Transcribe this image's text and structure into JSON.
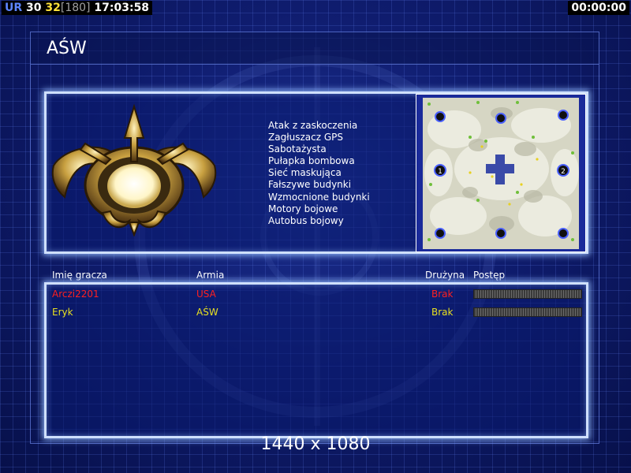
{
  "hud": {
    "tag": "UR",
    "value_a": "30",
    "value_b": "32",
    "value_c": "[180]",
    "clock": "17:03:58",
    "timer": "00:00:00"
  },
  "title": "AŚW",
  "features": [
    "Atak z zaskoczenia",
    "Zagłuszacz GPS",
    "Sabotażysta",
    "Pułapka bombowa",
    "Sieć maskująca",
    "Fałszywe budynki",
    "Wzmocnione budynki",
    "Motory bojowe",
    "Autobus bojowy"
  ],
  "minimap": {
    "start_labels": [
      "1",
      "2"
    ]
  },
  "players_header": {
    "name": "Imię gracza",
    "army": "Armia",
    "team": "Drużyna",
    "progress": "Postęp"
  },
  "players": [
    {
      "name": "Arczi2201",
      "army": "USA",
      "team": "Brak",
      "color": "#ff2020",
      "progress": 0
    },
    {
      "name": "Eryk",
      "army": "AŚW",
      "team": "Brak",
      "color": "#e8e020",
      "progress": 0
    }
  ],
  "resolution": "1440 x 1080"
}
